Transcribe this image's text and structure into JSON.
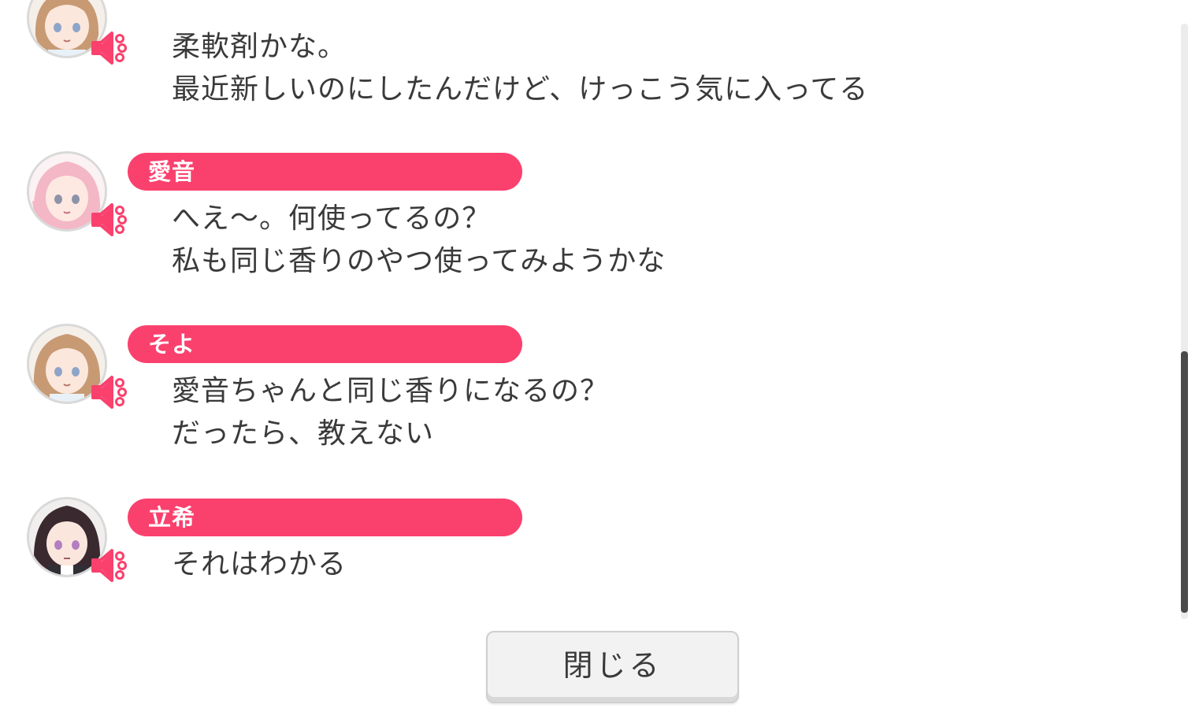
{
  "dialog": {
    "close_label": "閉じる"
  },
  "log": [
    {
      "speaker": "",
      "avatar_icon": "character-avatar-soyo",
      "lines": [
        "柔軟剤かな。",
        "最近新しいのにしたんだけど、けっこう気に入ってる"
      ]
    },
    {
      "speaker": "愛音",
      "avatar_icon": "character-avatar-anon",
      "lines": [
        "へえ～。何使ってるの？",
        "私も同じ香りのやつ使ってみようかな"
      ]
    },
    {
      "speaker": "そよ",
      "avatar_icon": "character-avatar-soyo",
      "lines": [
        "愛音ちゃんと同じ香りになるの？",
        "だったら、教えない"
      ]
    },
    {
      "speaker": "立希",
      "avatar_icon": "character-avatar-taki",
      "lines": [
        "それはわかる"
      ]
    }
  ],
  "colors": {
    "name_pill": "#fa416e",
    "text": "#3a3a3a",
    "voice_icon": "#fa416e",
    "scroll_thumb": "#4a4a4a"
  },
  "icons": {
    "voice": "speaker-icon"
  }
}
